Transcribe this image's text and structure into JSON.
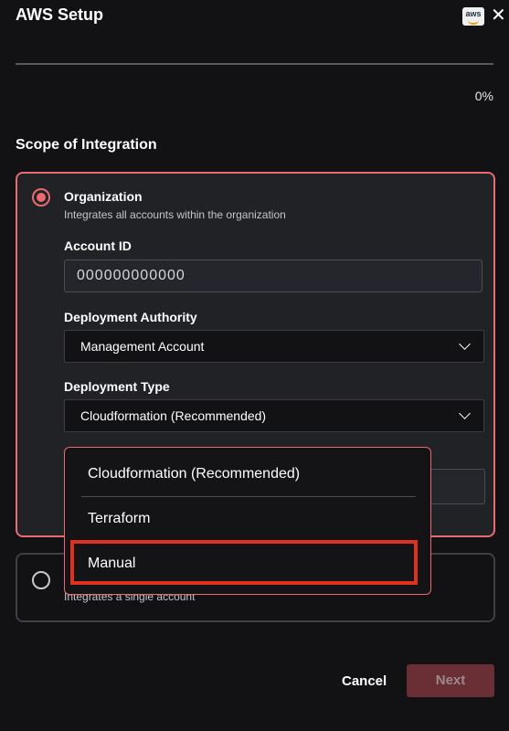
{
  "header": {
    "title": "AWS Setup",
    "logo_text": "aws",
    "close_icon": "close-icon"
  },
  "progress": {
    "value_percent": 0,
    "label": "0%"
  },
  "scope": {
    "title": "Scope of Integration",
    "organization": {
      "title": "Organization",
      "description": "Integrates all accounts within the organization",
      "selected": true
    },
    "single_account": {
      "title": "",
      "description": "Integrates a single account",
      "selected": false
    }
  },
  "form": {
    "account_id": {
      "label": "Account ID",
      "value": "000000000000"
    },
    "deployment_authority": {
      "label": "Deployment Authority",
      "value": "Management Account"
    },
    "deployment_type": {
      "label": "Deployment Type",
      "value": "Cloudformation (Recommended)",
      "options": [
        "Cloudformation (Recommended)",
        "Terraform",
        "Manual"
      ],
      "highlighted_option": "Manual"
    }
  },
  "footer": {
    "cancel_label": "Cancel",
    "next_label": "Next"
  },
  "colors": {
    "accent": "#e96b70",
    "highlight": "#e0301e",
    "background": "#121214",
    "card": "#202226"
  }
}
